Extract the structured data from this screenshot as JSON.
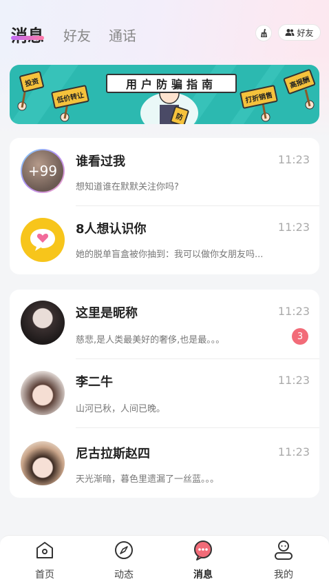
{
  "header": {
    "tabs": [
      {
        "label": "消息",
        "active": true
      },
      {
        "label": "好友",
        "active": false
      },
      {
        "label": "通话",
        "active": false
      }
    ],
    "friend_button_label": "好友",
    "clean_icon": "broom-icon",
    "friend_icon": "users-icon"
  },
  "banner": {
    "title": "用户防骗指南",
    "signs": [
      "投资",
      "低价转让",
      "打折销售",
      "高报酬",
      "防"
    ]
  },
  "system_messages": [
    {
      "title": "谁看过我",
      "subtitle": "想知道谁在默默关注你吗?",
      "time": "11:23",
      "avatar_text": "+99"
    },
    {
      "title": "8人想认识你",
      "subtitle": "她的脱单盲盒被你抽到：我可以做你女朋友吗...",
      "time": "11:23",
      "avatar_icon": "heart-chat-icon"
    }
  ],
  "chats": [
    {
      "name": "这里是昵称",
      "message": "慈悲,是人类最美好的奢侈,也是最。。。",
      "time": "11:23",
      "unread": "3"
    },
    {
      "name": "李二牛",
      "message": "山河已秋，人间已晚。",
      "time": "11:23",
      "unread": ""
    },
    {
      "name": "尼古拉斯赵四",
      "message": "天光渐暗，暮色里遗漏了一丝蓝。。。",
      "time": "11:23",
      "unread": ""
    }
  ],
  "bottom_nav": [
    {
      "label": "首页",
      "icon": "home-icon",
      "active": false
    },
    {
      "label": "动态",
      "icon": "compass-icon",
      "active": false
    },
    {
      "label": "消息",
      "icon": "message-icon",
      "active": true
    },
    {
      "label": "我的",
      "icon": "profile-icon",
      "active": false
    }
  ],
  "colors": {
    "accent_gradient_start": "#c06cf5",
    "accent_gradient_end": "#ff7aa8",
    "badge": "#f26b78",
    "banner_bg": "#2cb9b0",
    "chat_icon_yellow": "#f7c51b",
    "active_nav_icon": "#f26b78"
  }
}
